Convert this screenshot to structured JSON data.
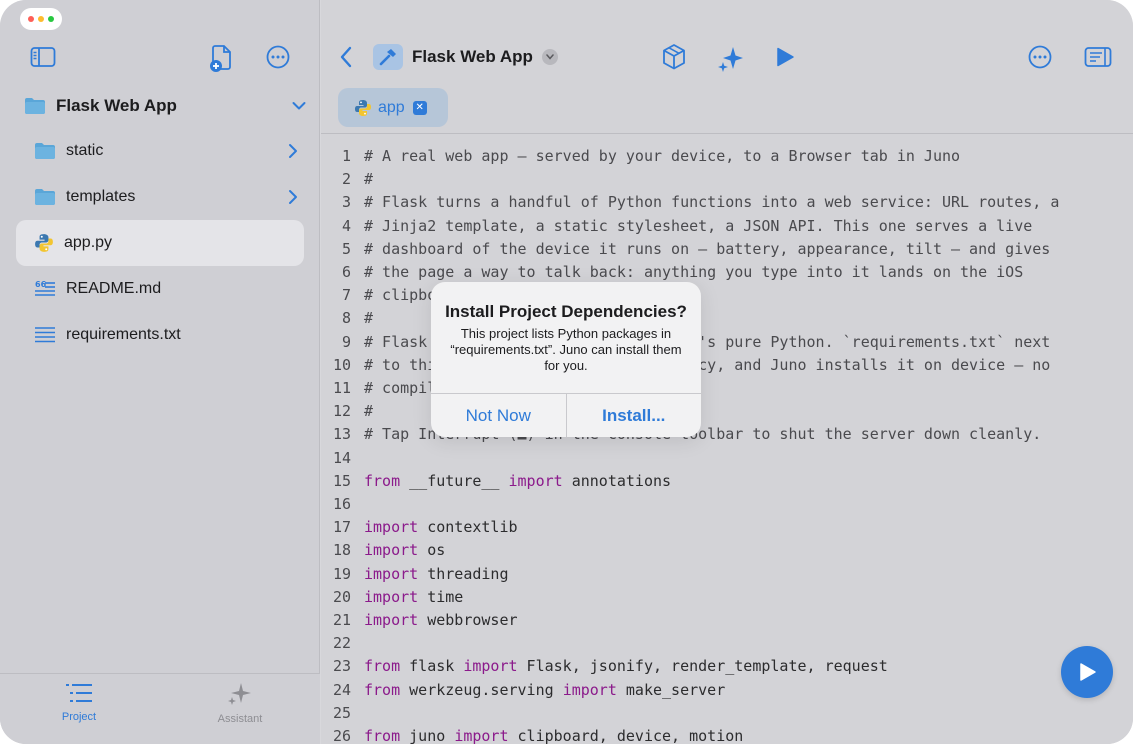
{
  "colors": {
    "accent": "#2f7bd8",
    "keyword": "#8b1a8b",
    "folder": "#5aa6d8",
    "python_blue": "#3b78b0",
    "python_yellow": "#f2c531",
    "window_red": "#fe5f57",
    "window_yellow": "#febc2e",
    "window_green": "#28c840"
  },
  "sidebar": {
    "project_name": "Flask Web App",
    "items": [
      {
        "label": "static",
        "icon": "folder-icon",
        "type": "folder",
        "selected": false
      },
      {
        "label": "templates",
        "icon": "folder-icon",
        "type": "folder",
        "selected": false
      },
      {
        "label": "app.py",
        "icon": "python-file-icon",
        "type": "file",
        "selected": true
      },
      {
        "label": "README.md",
        "icon": "markdown-file-icon",
        "type": "file",
        "selected": false
      },
      {
        "label": "requirements.txt",
        "icon": "text-file-icon",
        "type": "file",
        "selected": false
      }
    ],
    "bottom_tabs": [
      {
        "label": "Project",
        "icon": "list-icon",
        "active": true
      },
      {
        "label": "Assistant",
        "icon": "sparkles-icon",
        "active": false
      }
    ]
  },
  "toolbar": {
    "title": "Flask Web App"
  },
  "tab": {
    "name": "app"
  },
  "code": [
    {
      "n": "1",
      "p": [
        {
          "t": "# A real web app — served by your device, to a Browser tab in Juno",
          "c": "cm"
        }
      ]
    },
    {
      "n": "2",
      "p": [
        {
          "t": "#",
          "c": "cm"
        }
      ]
    },
    {
      "n": "3",
      "p": [
        {
          "t": "# Flask turns a handful of Python functions into a web service: URL routes, a",
          "c": "cm"
        }
      ]
    },
    {
      "n": "4",
      "p": [
        {
          "t": "# Jinja2 template, a static stylesheet, a JSON API. This one serves a live",
          "c": "cm"
        }
      ]
    },
    {
      "n": "5",
      "p": [
        {
          "t": "# dashboard of the device it runs on — battery, appearance, tilt — and gives",
          "c": "cm"
        }
      ]
    },
    {
      "n": "6",
      "p": [
        {
          "t": "# the page a way to talk back: anything you type into it lands on the iOS",
          "c": "cm"
        }
      ]
    },
    {
      "n": "7",
      "p": [
        {
          "t": "# clipboard.",
          "c": "cm"
        }
      ]
    },
    {
      "n": "8",
      "p": [
        {
          "t": "#",
          "c": "cm"
        }
      ]
    },
    {
      "n": "9",
      "p": [
        {
          "t": "# Flask has no native extensions — it's pure Python. `requirements.txt` next",
          "c": "cm"
        }
      ]
    },
    {
      "n": "10",
      "p": [
        {
          "t": "# to this file lists it as a dependency, and Juno installs it on device — no",
          "c": "cm"
        }
      ]
    },
    {
      "n": "11",
      "p": [
        {
          "t": "# compiling required.",
          "c": "cm"
        }
      ]
    },
    {
      "n": "12",
      "p": [
        {
          "t": "#",
          "c": "cm"
        }
      ]
    },
    {
      "n": "13",
      "p": [
        {
          "t": "# Tap Interrupt (■) in the console toolbar to shut the server down cleanly.",
          "c": "cm"
        }
      ]
    },
    {
      "n": "14",
      "p": []
    },
    {
      "n": "15",
      "p": [
        {
          "t": "from",
          "c": "kw"
        },
        {
          "t": " __future__ ",
          "c": ""
        },
        {
          "t": "import",
          "c": "kw"
        },
        {
          "t": " annotations",
          "c": ""
        }
      ]
    },
    {
      "n": "16",
      "p": []
    },
    {
      "n": "17",
      "p": [
        {
          "t": "import",
          "c": "kw"
        },
        {
          "t": " contextlib",
          "c": ""
        }
      ]
    },
    {
      "n": "18",
      "p": [
        {
          "t": "import",
          "c": "kw"
        },
        {
          "t": " os",
          "c": ""
        }
      ]
    },
    {
      "n": "19",
      "p": [
        {
          "t": "import",
          "c": "kw"
        },
        {
          "t": " threading",
          "c": ""
        }
      ]
    },
    {
      "n": "20",
      "p": [
        {
          "t": "import",
          "c": "kw"
        },
        {
          "t": " time",
          "c": ""
        }
      ]
    },
    {
      "n": "21",
      "p": [
        {
          "t": "import",
          "c": "kw"
        },
        {
          "t": " webbrowser",
          "c": ""
        }
      ]
    },
    {
      "n": "22",
      "p": []
    },
    {
      "n": "23",
      "p": [
        {
          "t": "from",
          "c": "kw"
        },
        {
          "t": " flask ",
          "c": ""
        },
        {
          "t": "import",
          "c": "kw"
        },
        {
          "t": " Flask, jsonify, render_template, request",
          "c": ""
        }
      ]
    },
    {
      "n": "24",
      "p": [
        {
          "t": "from",
          "c": "kw"
        },
        {
          "t": " werkzeug.serving ",
          "c": ""
        },
        {
          "t": "import",
          "c": "kw"
        },
        {
          "t": " make_server",
          "c": ""
        }
      ]
    },
    {
      "n": "25",
      "p": []
    },
    {
      "n": "26",
      "p": [
        {
          "t": "from",
          "c": "kw"
        },
        {
          "t": " juno ",
          "c": ""
        },
        {
          "t": "import",
          "c": "kw"
        },
        {
          "t": " clipboard, device, motion",
          "c": ""
        }
      ]
    }
  ],
  "alert": {
    "title": "Install Project Dependencies?",
    "message": "This project lists Python packages in “requirements.txt”. Juno can install them for you.",
    "cancel_label": "Not Now",
    "confirm_label": "Install..."
  }
}
